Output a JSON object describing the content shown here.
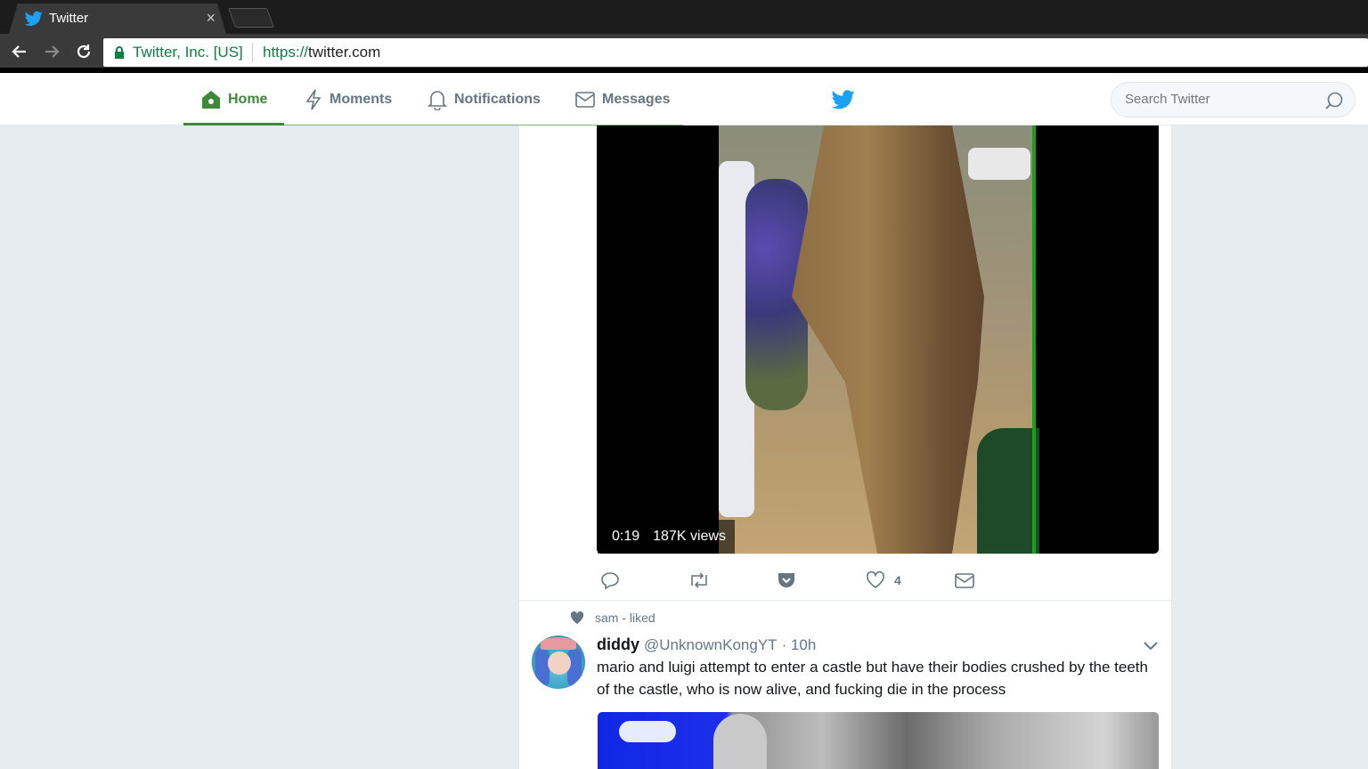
{
  "browser": {
    "tab_title": "Twitter",
    "tab_close": "×",
    "secure_label": "Twitter, Inc. [US]",
    "url_scheme": "https://",
    "url_host": "twitter.com"
  },
  "nav": {
    "items": [
      {
        "label": "Home",
        "icon": "home-icon",
        "active": true
      },
      {
        "label": "Moments",
        "icon": "lightning-icon"
      },
      {
        "label": "Notifications",
        "icon": "bell-icon"
      },
      {
        "label": "Messages",
        "icon": "envelope-icon"
      }
    ],
    "search_placeholder": "Search Twitter",
    "brand_icon": "twitter-bird-icon",
    "accent": "#3c8a38",
    "brand_color": "#1da1f2"
  },
  "video": {
    "duration": "0:19",
    "views": "187K views"
  },
  "tweet1_actions": {
    "reply_icon": "reply-icon",
    "retweet_icon": "retweet-icon",
    "save_icon": "pocket-icon",
    "like_icon": "heart-icon",
    "like_count": "4",
    "dm_icon": "envelope-icon"
  },
  "tweet2": {
    "context": "sam - liked",
    "name": "diddy",
    "handle": "@UnknownKongYT",
    "time": "· 10h",
    "text": "mario and luigi attempt to enter a castle but have their bodies crushed by the teeth of the castle, who is now alive, and fucking die in the process"
  }
}
